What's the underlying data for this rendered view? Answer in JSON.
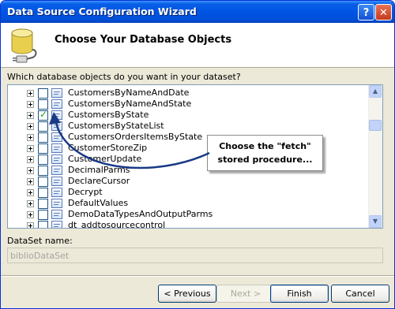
{
  "window": {
    "title": "Data Source Configuration Wizard"
  },
  "titlebar": {
    "help_glyph": "?",
    "close_glyph": "✕"
  },
  "header": {
    "heading": "Choose Your Database Objects",
    "icon": "database-plug-icon"
  },
  "prompt": "Which database objects do you want in your dataset?",
  "objects": [
    {
      "label": "CustomersByNameAndDate",
      "checked": false
    },
    {
      "label": "CustomersByNameAndState",
      "checked": false
    },
    {
      "label": "CustomersByState",
      "checked": true
    },
    {
      "label": "CustomersByStateList",
      "checked": false
    },
    {
      "label": "CustomersOrdersItemsByState",
      "checked": false
    },
    {
      "label": "CustomerStoreZip",
      "checked": false
    },
    {
      "label": "CustomerUpdate",
      "checked": false
    },
    {
      "label": "DecimalParms",
      "checked": false
    },
    {
      "label": "DeclareCursor",
      "checked": false
    },
    {
      "label": "Decrypt",
      "checked": false
    },
    {
      "label": "DefaultValues",
      "checked": false
    },
    {
      "label": "DemoDataTypesAndOutputParms",
      "checked": false
    },
    {
      "label": "dt_addtosourcecontrol",
      "checked": false
    }
  ],
  "callout": {
    "line1": "Choose the \"fetch\"",
    "line2": "stored procedure..."
  },
  "dataset": {
    "label": "DataSet name:",
    "value": "biblioDataSet"
  },
  "buttons": {
    "previous": "< Previous",
    "next": "Next >",
    "finish": "Finish",
    "cancel": "Cancel"
  },
  "colors": {
    "titlebar": "#0054e3",
    "callout_arrow": "#1a3a86",
    "check": "#21a121"
  }
}
